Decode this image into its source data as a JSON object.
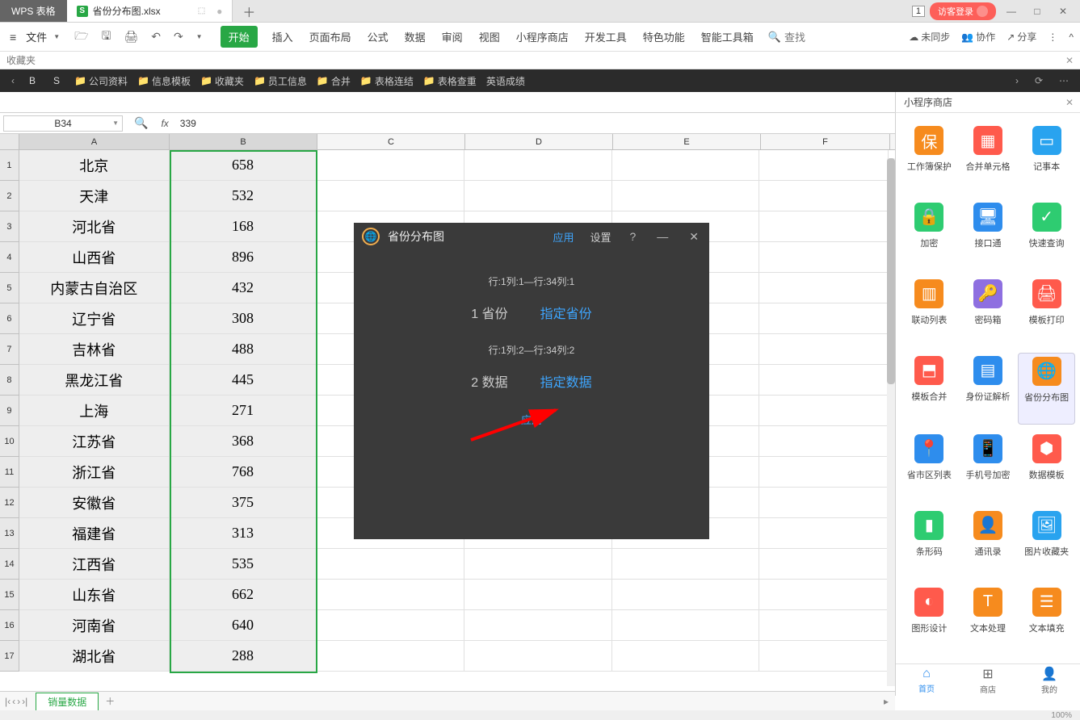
{
  "tab_bar": {
    "wps_label": "WPS 表格",
    "file_icon": "S",
    "file_name": "省份分布图.xlsx",
    "add": "＋",
    "window_num": "1",
    "guest_login": "访客登录",
    "min": "—",
    "max": "□",
    "close": "✕"
  },
  "menu": {
    "file_label": "文件",
    "tabs": [
      "开始",
      "插入",
      "页面布局",
      "公式",
      "数据",
      "审阅",
      "视图",
      "小程序商店",
      "开发工具",
      "特色功能",
      "智能工具箱"
    ],
    "active_index": 0,
    "search": "查找",
    "right": {
      "sync": "未同步",
      "coop": "协作",
      "share": "分享"
    }
  },
  "favorites": {
    "label": "收藏夹"
  },
  "bookmarks": {
    "letters": [
      "B",
      "S"
    ],
    "items": [
      "公司资料",
      "信息模板",
      "收藏夹",
      "员工信息",
      "合并",
      "表格连结",
      "表格查重",
      "英语成绩"
    ]
  },
  "formula": {
    "cell_ref": "B34",
    "value": "339"
  },
  "columns": [
    "A",
    "B",
    "C",
    "D",
    "E",
    "F"
  ],
  "rows": [
    {
      "n": 1,
      "a": "北京",
      "b": "658"
    },
    {
      "n": 2,
      "a": "天津",
      "b": "532"
    },
    {
      "n": 3,
      "a": "河北省",
      "b": "168"
    },
    {
      "n": 4,
      "a": "山西省",
      "b": "896"
    },
    {
      "n": 5,
      "a": "内蒙古自治区",
      "b": "432"
    },
    {
      "n": 6,
      "a": "辽宁省",
      "b": "308"
    },
    {
      "n": 7,
      "a": "吉林省",
      "b": "488"
    },
    {
      "n": 8,
      "a": "黑龙江省",
      "b": "445"
    },
    {
      "n": 9,
      "a": "上海",
      "b": "271"
    },
    {
      "n": 10,
      "a": "江苏省",
      "b": "368"
    },
    {
      "n": 11,
      "a": "浙江省",
      "b": "768"
    },
    {
      "n": 12,
      "a": "安徽省",
      "b": "375"
    },
    {
      "n": 13,
      "a": "福建省",
      "b": "313"
    },
    {
      "n": 14,
      "a": "江西省",
      "b": "535"
    },
    {
      "n": 15,
      "a": "山东省",
      "b": "662"
    },
    {
      "n": 16,
      "a": "河南省",
      "b": "640"
    },
    {
      "n": 17,
      "a": "湖北省",
      "b": "288"
    }
  ],
  "sheet_tab": "销量数据",
  "side": {
    "title": "小程序商店",
    "items": [
      {
        "label": "工作簿保护",
        "bg": "#f68b1e",
        "glyph": "保"
      },
      {
        "label": "合并单元格",
        "bg": "#ff5a4c",
        "glyph": "▦"
      },
      {
        "label": "记事本",
        "bg": "#29a3ef",
        "glyph": "▭"
      },
      {
        "label": "加密",
        "bg": "#2ecc71",
        "glyph": "🔒"
      },
      {
        "label": "接口通",
        "bg": "#2e8ded",
        "glyph": "🖥"
      },
      {
        "label": "快速查询",
        "bg": "#2ecc71",
        "glyph": "✓"
      },
      {
        "label": "联动列表",
        "bg": "#f68b1e",
        "glyph": "▥"
      },
      {
        "label": "密码箱",
        "bg": "#8e6fe0",
        "glyph": "🔑"
      },
      {
        "label": "模板打印",
        "bg": "#ff5a4c",
        "glyph": "🖨"
      },
      {
        "label": "模板合并",
        "bg": "#ff5a4c",
        "glyph": "⬒"
      },
      {
        "label": "身份证解析",
        "bg": "#2e8ded",
        "glyph": "▤"
      },
      {
        "label": "省份分布图",
        "bg": "#f68b1e",
        "glyph": "🌐"
      },
      {
        "label": "省市区列表",
        "bg": "#2e8ded",
        "glyph": "📍"
      },
      {
        "label": "手机号加密",
        "bg": "#2e8ded",
        "glyph": "📱"
      },
      {
        "label": "数据模板",
        "bg": "#ff5a4c",
        "glyph": "⬢"
      },
      {
        "label": "条形码",
        "bg": "#2ecc71",
        "glyph": "▮"
      },
      {
        "label": "通讯录",
        "bg": "#f68b1e",
        "glyph": "👤"
      },
      {
        "label": "图片收藏夹",
        "bg": "#29a3ef",
        "glyph": "🖼"
      },
      {
        "label": "图形设计",
        "bg": "#ff5a4c",
        "glyph": "◐"
      },
      {
        "label": "文本处理",
        "bg": "#f68b1e",
        "glyph": "T"
      },
      {
        "label": "文本填充",
        "bg": "#f68b1e",
        "glyph": "☰"
      }
    ],
    "selected_index": 11,
    "nav": [
      {
        "label": "首页",
        "glyph": "⌂",
        "active": true
      },
      {
        "label": "商店",
        "glyph": "⊞",
        "active": false
      },
      {
        "label": "我的",
        "glyph": "👤",
        "active": false
      }
    ]
  },
  "dialog": {
    "title": "省份分布图",
    "apply": "应用",
    "settings": "设置",
    "help": "?",
    "min": "—",
    "close": "✕",
    "range1": "行:1列:1—行:34列:1",
    "label1_num": "1",
    "label1": "省份",
    "action1": "指定省份",
    "range2": "行:1列:2—行:34列:2",
    "label2_num": "2",
    "label2": "数据",
    "action2": "指定数据",
    "apply2": "应用"
  },
  "status": {
    "zoom": "100%"
  }
}
